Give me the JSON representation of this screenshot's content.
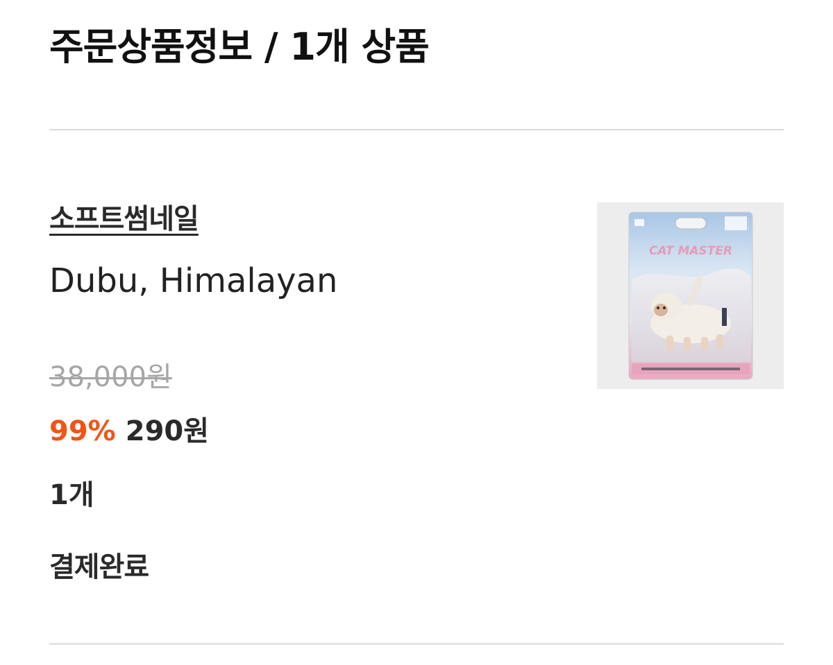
{
  "order": {
    "title": "주문상품정보 / 1개 상품"
  },
  "item": {
    "brand": "소프트썸네일",
    "name": "Dubu, Himalayan",
    "original_price": "38,000원",
    "discount": "99%",
    "sale_price": "290원",
    "quantity": "1개",
    "status": "결제완료",
    "thumbnail": {
      "icon": "product-package-image",
      "package_title": "CAT MASTER"
    }
  },
  "colors": {
    "discount": "#f25416",
    "original_price": "#a6a6a6",
    "divider": "#d9d9d9"
  }
}
